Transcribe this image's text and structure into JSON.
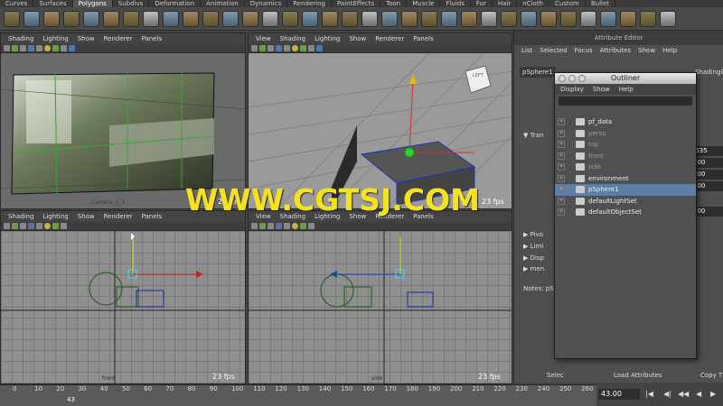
{
  "tabs": [
    {
      "label": "Curves"
    },
    {
      "label": "Surfaces"
    },
    {
      "label": "Polygons"
    },
    {
      "label": "Subdivs"
    },
    {
      "label": "Deformation"
    },
    {
      "label": "Animation"
    },
    {
      "label": "Dynamics"
    },
    {
      "label": "Rendering"
    },
    {
      "label": "PaintEffects"
    },
    {
      "label": "Toon"
    },
    {
      "label": "Muscle"
    },
    {
      "label": "Fluids"
    },
    {
      "label": "Fur"
    },
    {
      "label": "Hair"
    },
    {
      "label": "nCloth"
    },
    {
      "label": "Custom"
    },
    {
      "label": "Bullet"
    }
  ],
  "active_tab": "Polygons",
  "panel_menu_short": [
    "Shading",
    "Lighting",
    "Show",
    "Renderer",
    "Panels"
  ],
  "panel_menu_full": [
    "View",
    "Shading",
    "Lighting",
    "Show",
    "Renderer",
    "Panels"
  ],
  "viewports": {
    "camera": {
      "label": "Camera_1_1",
      "fps": "23 fps"
    },
    "persp": {
      "fps": "23 fps",
      "cube_label": "LEFT"
    },
    "front": {
      "label": "front",
      "fps": "23 fps"
    },
    "side": {
      "label": "side",
      "fps": "23 fps"
    }
  },
  "attribute_editor": {
    "title": "Attribute Editor",
    "menu": [
      "List",
      "Selected",
      "Focus",
      "Attributes",
      "Show",
      "Help"
    ],
    "node_tab": "pSphere1",
    "shading_tab": "ShadingG",
    "sections": [
      "Tran",
      "Pivo",
      "Limi",
      "Disp",
      "men"
    ],
    "values": [
      ".635",
      "000",
      "000",
      "000",
      "000"
    ],
    "notes_label": "Notes: pS",
    "bottom_buttons": [
      "Selec",
      "Load Attributes",
      "Copy T"
    ]
  },
  "outliner": {
    "title": "Outliner",
    "menu": [
      "Display",
      "Show",
      "Help"
    ],
    "items": [
      {
        "label": "pf_data",
        "dim": false,
        "selected": false
      },
      {
        "label": "persp",
        "dim": true,
        "selected": false
      },
      {
        "label": "top",
        "dim": true,
        "selected": false
      },
      {
        "label": "front",
        "dim": true,
        "selected": false
      },
      {
        "label": "side",
        "dim": true,
        "selected": false
      },
      {
        "label": "environment",
        "dim": false,
        "selected": false
      },
      {
        "label": "pSphere1",
        "dim": false,
        "selected": true
      },
      {
        "label": "defaultLightSet",
        "dim": false,
        "selected": false
      },
      {
        "label": "defaultObjectSet",
        "dim": false,
        "selected": false
      }
    ]
  },
  "timeline": {
    "ticks": [
      "0",
      "10",
      "20",
      "30",
      "40",
      "50",
      "60",
      "70",
      "80",
      "90",
      "100",
      "110",
      "120",
      "130",
      "140",
      "150",
      "160",
      "170",
      "180",
      "190",
      "200",
      "210",
      "220",
      "230",
      "240",
      "250",
      "260"
    ],
    "current_marker": "43",
    "current_frame": "43.00"
  },
  "watermark": "WWW.CGTSJ.COM"
}
